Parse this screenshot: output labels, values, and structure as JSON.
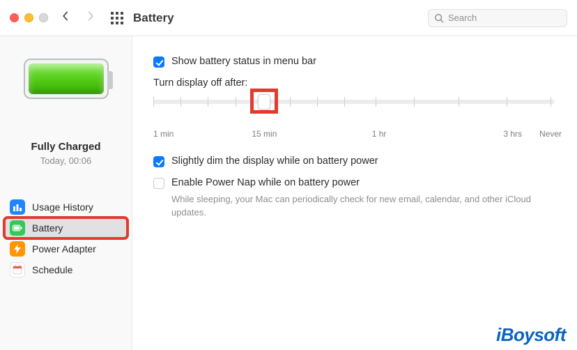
{
  "toolbar": {
    "title": "Battery",
    "search_placeholder": "Search"
  },
  "sidebar": {
    "battery_status_title": "Fully Charged",
    "battery_status_sub": "Today, 00:06",
    "items": [
      {
        "label": "Usage History"
      },
      {
        "label": "Battery"
      },
      {
        "label": "Power Adapter"
      },
      {
        "label": "Schedule"
      }
    ],
    "active_index": 1
  },
  "content": {
    "show_status_label": "Show battery status in menu bar",
    "show_status_checked": true,
    "slider_label": "Turn display off after:",
    "slider_captions": {
      "min": "1 min",
      "fifteen": "15 min",
      "hour": "1 hr",
      "three_hours": "3 hrs",
      "never": "Never"
    },
    "dim_label": "Slightly dim the display while on battery power",
    "dim_checked": true,
    "powernap_label": "Enable Power Nap while on battery power",
    "powernap_checked": false,
    "powernap_help": "While sleeping, your Mac can periodically check for new email, calendar, and other iCloud updates."
  },
  "watermark": "iBoysoft"
}
